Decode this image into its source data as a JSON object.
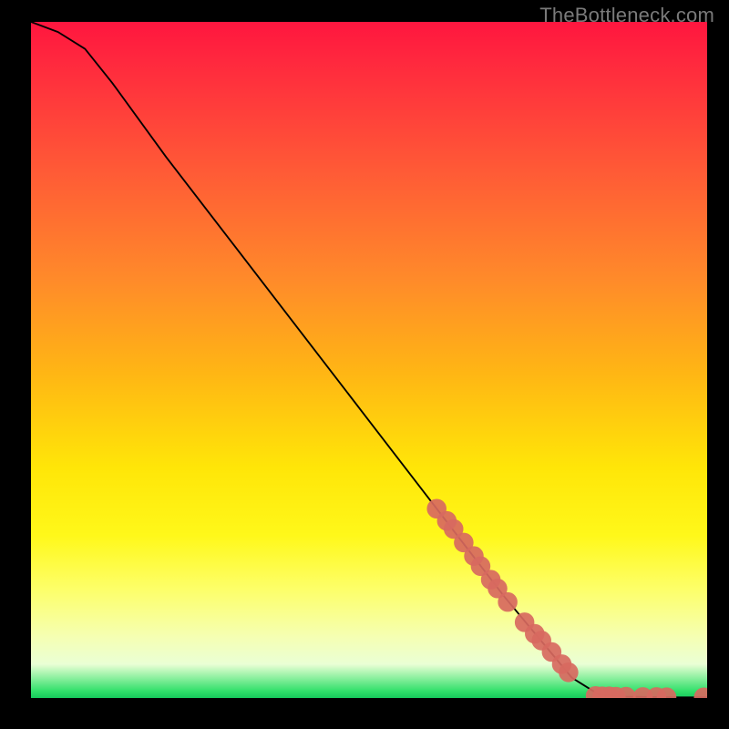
{
  "attribution": "TheBottleneck.com",
  "chart_data": {
    "type": "line",
    "title": "",
    "xlabel": "",
    "ylabel": "",
    "xlim": [
      0,
      100
    ],
    "ylim": [
      0,
      100
    ],
    "grid": false,
    "legend": false,
    "series": [
      {
        "name": "curve",
        "x": [
          0,
          4,
          8,
          12,
          20,
          30,
          40,
          50,
          60,
          70,
          75,
          80,
          84,
          88,
          92,
          96,
          100
        ],
        "y": [
          100,
          98.5,
          96,
          91,
          80,
          67,
          54,
          41,
          28,
          15,
          9,
          3,
          0.5,
          0.2,
          0.15,
          0.1,
          0.1
        ]
      }
    ],
    "scatter": {
      "name": "highlighted-points",
      "color": "#d86a60",
      "points": [
        {
          "x": 60.0,
          "y": 28.0
        },
        {
          "x": 61.5,
          "y": 26.2
        },
        {
          "x": 62.5,
          "y": 25.0
        },
        {
          "x": 64.0,
          "y": 23.0
        },
        {
          "x": 65.5,
          "y": 21.0
        },
        {
          "x": 66.5,
          "y": 19.5
        },
        {
          "x": 68.0,
          "y": 17.5
        },
        {
          "x": 69.0,
          "y": 16.2
        },
        {
          "x": 70.5,
          "y": 14.2
        },
        {
          "x": 73.0,
          "y": 11.2
        },
        {
          "x": 74.5,
          "y": 9.5
        },
        {
          "x": 75.5,
          "y": 8.5
        },
        {
          "x": 77.0,
          "y": 6.8
        },
        {
          "x": 78.5,
          "y": 5.0
        },
        {
          "x": 79.5,
          "y": 3.8
        },
        {
          "x": 83.5,
          "y": 0.3
        },
        {
          "x": 84.5,
          "y": 0.25
        },
        {
          "x": 85.5,
          "y": 0.25
        },
        {
          "x": 86.5,
          "y": 0.2
        },
        {
          "x": 88.0,
          "y": 0.2
        },
        {
          "x": 90.5,
          "y": 0.15
        },
        {
          "x": 92.5,
          "y": 0.15
        },
        {
          "x": 94.0,
          "y": 0.12
        },
        {
          "x": 99.5,
          "y": 0.1
        }
      ]
    }
  }
}
